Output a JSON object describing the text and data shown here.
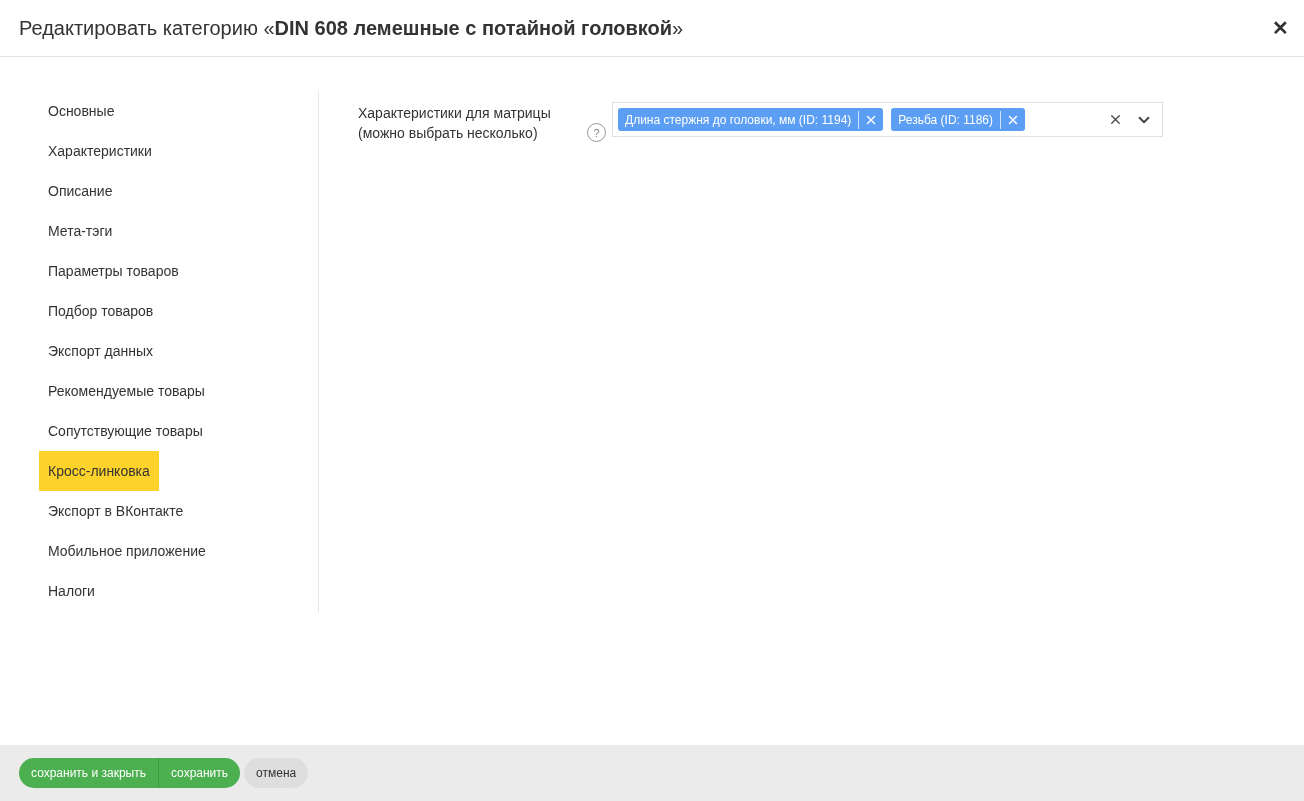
{
  "window": {
    "title": "Редактировать категорию «**DIN 608 лемешные с потайной головкой**»",
    "close": "✕"
  },
  "sidebar": {
    "items": [
      {
        "label": "Основные",
        "selected": false
      },
      {
        "label": "Характеристики",
        "selected": false
      },
      {
        "label": "Описание",
        "selected": false
      },
      {
        "label": "Мета-тэги",
        "selected": false
      },
      {
        "label": "Параметры товаров",
        "selected": false
      },
      {
        "label": "Подбор товаров",
        "selected": false
      },
      {
        "label": "Экспорт данных",
        "selected": false
      },
      {
        "label": "Рекомендуемые товары",
        "selected": false
      },
      {
        "label": "Сопутствующие товары",
        "selected": false
      },
      {
        "label": "Кросс-линковка",
        "selected": true
      },
      {
        "label": "Экспорт в ВКонтакте",
        "selected": false
      },
      {
        "label": "Мобильное приложение",
        "selected": false
      },
      {
        "label": "Налоги",
        "selected": false
      }
    ]
  },
  "field": {
    "label": "Характеристики для матрицы (можно выбрать несколько)",
    "help": "?",
    "tags": [
      {
        "label": "Длина стержня до головки, мм (ID: 1194)"
      },
      {
        "label": "Резьба (ID: 1186)"
      }
    ]
  },
  "footer": {
    "buttons": [
      {
        "label": "сохранить и закрыть",
        "kind": "primary"
      },
      {
        "label": "сохранить",
        "kind": "primary"
      },
      {
        "label": "отмена",
        "kind": "secondary"
      }
    ]
  }
}
